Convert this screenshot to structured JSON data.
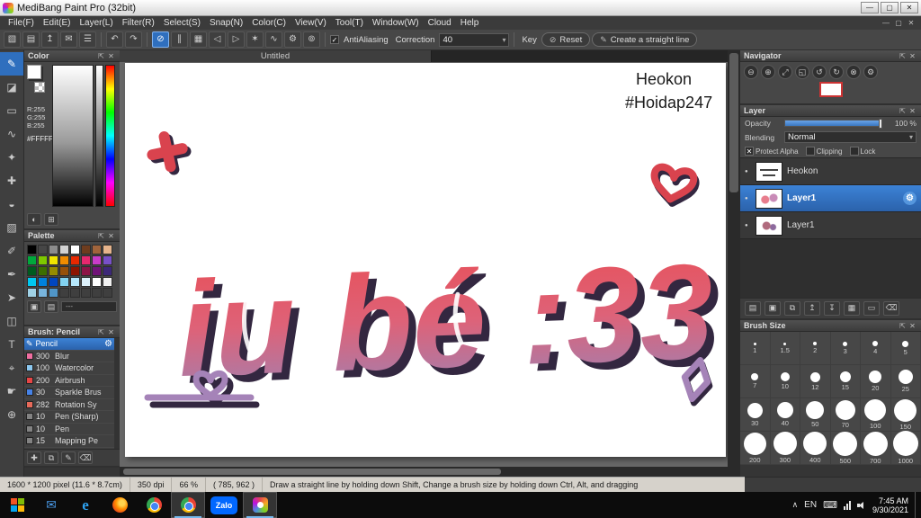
{
  "ui": {
    "float_icon": "⇱",
    "close_icon": "✕",
    "dropdown_arrow": "▾",
    "undo_icon": "↶",
    "redo_icon": "↷",
    "check": "✓",
    "visibility_dot": "●",
    "caret": "∧",
    "keyboard_icon": "⌨"
  },
  "window": {
    "title": "MediBang Paint Pro (32bit)",
    "controls": [
      {
        "name": "minimize",
        "glyph": "—"
      },
      {
        "name": "maximize",
        "glyph": "▢"
      },
      {
        "name": "close",
        "glyph": "✕"
      }
    ]
  },
  "menu_bar": {
    "items": [
      "File(F)",
      "Edit(E)",
      "Layer(L)",
      "Filter(R)",
      "Select(S)",
      "Snap(N)",
      "Color(C)",
      "View(V)",
      "Tool(T)",
      "Window(W)",
      "Cloud",
      "Help"
    ]
  },
  "toolbar": {
    "file_icons": [
      {
        "name": "new-canvas-icon",
        "glyph": "▧"
      },
      {
        "name": "save-icon",
        "glyph": "▤"
      },
      {
        "name": "upload-icon",
        "glyph": "↥"
      },
      {
        "name": "message-icon",
        "glyph": "✉"
      },
      {
        "name": "pages-icon",
        "glyph": "☰"
      }
    ],
    "snap_icons": [
      {
        "name": "snap-off-icon",
        "glyph": "⊘",
        "selected": true
      },
      {
        "name": "snap-parallel-icon",
        "glyph": "∥"
      },
      {
        "name": "snap-grid-icon",
        "glyph": "▦"
      },
      {
        "name": "snap-left-icon",
        "glyph": "◁"
      },
      {
        "name": "snap-right-icon",
        "glyph": "▷"
      },
      {
        "name": "snap-vanishing-icon",
        "glyph": "✶"
      },
      {
        "name": "snap-curve-icon",
        "glyph": "∿"
      },
      {
        "name": "snap-settings-icon",
        "glyph": "⚙"
      },
      {
        "name": "snap-rotate-icon",
        "glyph": "⊚"
      }
    ],
    "antialiasing_label": "AntiAliasing",
    "correction_label": "Correction",
    "correction_value": "40",
    "key_label": "Key",
    "reset_label": "Reset",
    "reset_icon": "⊘",
    "straight_line_label": "Create a straight line",
    "straight_line_icon": "✎"
  },
  "document_tab": {
    "label": "Untitled"
  },
  "tool_strip": {
    "items": [
      {
        "name": "brush-tool",
        "glyph": "✎",
        "selected": true
      },
      {
        "name": "eraser-tool",
        "glyph": "◪"
      },
      {
        "name": "select-tool",
        "glyph": "▭"
      },
      {
        "name": "lasso-tool",
        "glyph": "∿"
      },
      {
        "name": "magic-wand-tool",
        "glyph": "✦"
      },
      {
        "name": "move-tool",
        "glyph": "✚"
      },
      {
        "name": "bucket-tool",
        "glyph": "◒"
      },
      {
        "name": "gradient-tool",
        "glyph": "▨"
      },
      {
        "name": "select-pen-tool",
        "glyph": "✐"
      },
      {
        "name": "pen-tool",
        "glyph": "✒"
      },
      {
        "name": "operation-tool",
        "glyph": "➤"
      },
      {
        "name": "divide-tool",
        "glyph": "◫"
      },
      {
        "name": "text-tool",
        "glyph": "T"
      },
      {
        "name": "eyedropper-tool",
        "glyph": "⌖"
      },
      {
        "name": "hand-tool",
        "glyph": "☛"
      },
      {
        "name": "zoom-tool",
        "glyph": "⊕"
      }
    ]
  },
  "color_panel": {
    "title": "Color",
    "rgb_lines": [
      "R:255",
      "G:255",
      "B:255"
    ],
    "hex": "#FFFFFF",
    "footer_icons": [
      {
        "name": "web-color-icon",
        "glyph": "◐"
      },
      {
        "name": "color-grid-icon",
        "glyph": "⊞"
      }
    ]
  },
  "palette_panel": {
    "title": "Palette",
    "colors": [
      "#000000",
      "#464646",
      "#8c8c8c",
      "#d2d2d2",
      "#ffffff",
      "#6e3c1e",
      "#a0643c",
      "#e6b48c",
      "#00a83c",
      "#7ec800",
      "#f0e600",
      "#f08c00",
      "#e62800",
      "#e6286e",
      "#c83cc8",
      "#7850c8",
      "#005a1e",
      "#3c6e00",
      "#968c00",
      "#96500a",
      "#8c1400",
      "#8c1446",
      "#701478",
      "#3c2878",
      "#00c8f0",
      "#0082dc",
      "#0046be",
      "#82d2f0",
      "#b4e6fa",
      "#dcf0fa",
      "#ffffff",
      "#f0f0f0",
      "#a0d2e6",
      "#78b4dc",
      "#5096c8",
      "",
      "",
      "",
      "",
      ""
    ],
    "footer_icons": [
      {
        "name": "add-palette-color-icon",
        "glyph": "▣"
      },
      {
        "name": "palette-menu-icon",
        "glyph": "▤"
      }
    ],
    "footer_label": "---"
  },
  "brush_panel": {
    "title": "Brush: Pencil",
    "gear_icon": "⚙",
    "brushes": [
      {
        "name": "Pencil",
        "size": "",
        "chip": "",
        "selected": true
      },
      {
        "name": "Blur",
        "size": "300",
        "chip": "#f06ea0"
      },
      {
        "name": "Watercolor",
        "size": "100",
        "chip": "#8cc8f0"
      },
      {
        "name": "Airbrush",
        "size": "200",
        "chip": "#e64545"
      },
      {
        "name": "Sparkle Brus",
        "size": "30",
        "chip": "#4682e6"
      },
      {
        "name": "Rotation Sy",
        "size": "282",
        "chip": "#e66a5a"
      },
      {
        "name": "Pen (Sharp)",
        "size": "10",
        "chip": "#828282"
      },
      {
        "name": "Pen",
        "size": "10",
        "chip": "#828282"
      },
      {
        "name": "Mapping Pe",
        "size": "15",
        "chip": "#828282"
      }
    ],
    "footer_icons": [
      {
        "name": "add-brush-icon",
        "glyph": "✚"
      },
      {
        "name": "duplicate-brush-icon",
        "glyph": "⧉"
      },
      {
        "name": "edit-brush-icon",
        "glyph": "✎"
      },
      {
        "name": "delete-brush-icon",
        "glyph": "⌫"
      }
    ]
  },
  "navigator_panel": {
    "title": "Navigator",
    "icons": [
      {
        "name": "zoom-out-icon",
        "glyph": "⊖"
      },
      {
        "name": "zoom-in-icon",
        "glyph": "⊕"
      },
      {
        "name": "zoom-fit-icon",
        "glyph": "⤢"
      },
      {
        "name": "zoom-actual-icon",
        "glyph": "◱"
      },
      {
        "name": "rotate-left-icon",
        "glyph": "↺"
      },
      {
        "name": "rotate-right-icon",
        "glyph": "↻"
      },
      {
        "name": "reset-view-icon",
        "glyph": "⊗"
      },
      {
        "name": "navigator-settings-icon",
        "glyph": "⚙"
      }
    ],
    "view_rect_color": "#cc3333"
  },
  "layer_panel": {
    "title": "Layer",
    "opacity_label": "Opacity",
    "opacity_value": "100 %",
    "blending_label": "Blending",
    "blending_value": "Normal",
    "gear_icon": "⚙",
    "checkboxes": [
      {
        "label": "Protect Alpha",
        "checked": true
      },
      {
        "label": "Clipping",
        "checked": false
      },
      {
        "label": "Lock",
        "checked": false
      }
    ],
    "layers": [
      {
        "name": "Heokon",
        "selected": false,
        "thumb": "text"
      },
      {
        "name": "Layer1",
        "selected": true,
        "thumb": "art"
      },
      {
        "name": "Layer1",
        "selected": false,
        "thumb": "art2"
      }
    ],
    "footer_icons": [
      {
        "name": "new-layer-icon",
        "glyph": "▤"
      },
      {
        "name": "new-folder-icon",
        "glyph": "▣"
      },
      {
        "name": "duplicate-layer-icon",
        "glyph": "⧉"
      },
      {
        "name": "move-up-icon",
        "glyph": "↥"
      },
      {
        "name": "move-down-icon",
        "glyph": "↧"
      },
      {
        "name": "merge-layer-icon",
        "glyph": "▦"
      },
      {
        "name": "clear-layer-icon",
        "glyph": "▭"
      },
      {
        "name": "delete-layer-icon",
        "glyph": "⌫"
      }
    ]
  },
  "brush_size_panel": {
    "title": "Brush Size",
    "sizes": [
      "1",
      "1.5",
      "2",
      "3",
      "4",
      "5",
      "7",
      "10",
      "12",
      "15",
      "20",
      "25",
      "30",
      "40",
      "50",
      "70",
      "100",
      "150",
      "200",
      "300",
      "400",
      "500",
      "700",
      "1000"
    ]
  },
  "canvas": {
    "annotation_line1": "Heokon",
    "annotation_line2": "#Hoidap247",
    "lettering": "iu bé :33",
    "gradient": {
      "top": "#e84f57",
      "mid": "#de6278",
      "bottom": "#9d82b4"
    },
    "colors": {
      "shadow": "#332740",
      "red": "#d9434e",
      "purple": "#a583b8",
      "ink": "#1a1a1a"
    }
  },
  "status_bar": {
    "dimensions": "1600 * 1200 pixel  (11.6 * 8.7cm)",
    "dpi": "350 dpi",
    "zoom": "66 %",
    "coords": "( 785, 962 )",
    "hint": "Draw a straight line by holding down Shift, Change a brush size by holding down Ctrl, Alt, and dragging"
  },
  "taskbar": {
    "zalo_label": "Zalo",
    "tray": {
      "lang": "EN",
      "time": "7:45 AM",
      "date": "9/30/2021"
    }
  }
}
